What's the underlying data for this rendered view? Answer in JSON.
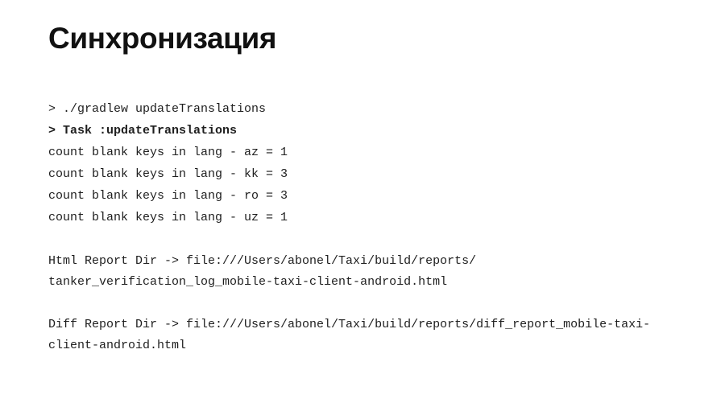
{
  "slide": {
    "title": "Синхронизация",
    "background_color": "#ffffff",
    "text_color": "#1e1e1e",
    "title_color": "#111111"
  },
  "console": {
    "groups": [
      {
        "name": "gradle-invocation",
        "lines": [
          {
            "style": "cmd",
            "text": "> ./gradlew updateTranslations"
          },
          {
            "style": "task",
            "text": "> Task :updateTranslations"
          },
          {
            "style": "plain",
            "text": "count blank keys in lang - az = 1"
          },
          {
            "style": "plain",
            "text": "count blank keys in lang - kk = 3"
          },
          {
            "style": "plain",
            "text": "count blank keys in lang - ro = 3"
          },
          {
            "style": "plain",
            "text": "count blank keys in lang - uz = 1"
          }
        ]
      },
      {
        "name": "html-report",
        "lines": [
          {
            "style": "plain",
            "text": "Html Report Dir -> file:///Users/abonel/Taxi/build/reports/"
          },
          {
            "style": "wrap",
            "text": "tanker_verification_log_mobile-taxi-client-android.html"
          }
        ]
      },
      {
        "name": "diff-report",
        "lines": [
          {
            "style": "plain",
            "text": "Diff Report Dir -> file:///Users/abonel/Taxi/build/reports/diff_report_mobile-taxi-"
          },
          {
            "style": "wrap",
            "text": "client-android.html"
          }
        ]
      }
    ]
  }
}
